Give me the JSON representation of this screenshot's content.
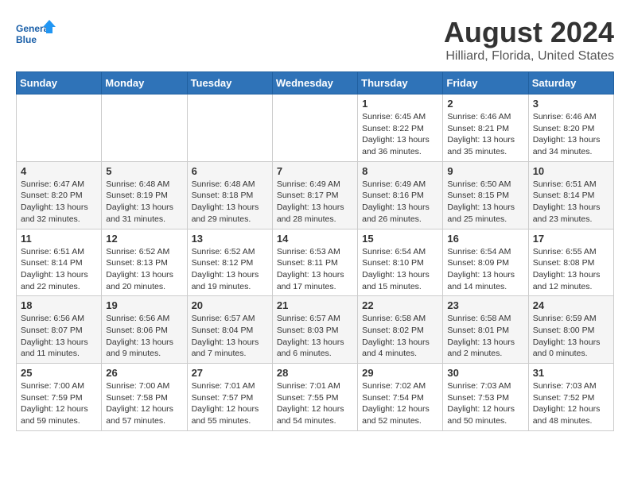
{
  "logo": {
    "name": "General",
    "name2": "Blue"
  },
  "header": {
    "title": "August 2024",
    "subtitle": "Hilliard, Florida, United States"
  },
  "weekdays": [
    "Sunday",
    "Monday",
    "Tuesday",
    "Wednesday",
    "Thursday",
    "Friday",
    "Saturday"
  ],
  "weeks": [
    [
      {
        "day": "",
        "info": ""
      },
      {
        "day": "",
        "info": ""
      },
      {
        "day": "",
        "info": ""
      },
      {
        "day": "",
        "info": ""
      },
      {
        "day": "1",
        "info": "Sunrise: 6:45 AM\nSunset: 8:22 PM\nDaylight: 13 hours\nand 36 minutes."
      },
      {
        "day": "2",
        "info": "Sunrise: 6:46 AM\nSunset: 8:21 PM\nDaylight: 13 hours\nand 35 minutes."
      },
      {
        "day": "3",
        "info": "Sunrise: 6:46 AM\nSunset: 8:20 PM\nDaylight: 13 hours\nand 34 minutes."
      }
    ],
    [
      {
        "day": "4",
        "info": "Sunrise: 6:47 AM\nSunset: 8:20 PM\nDaylight: 13 hours\nand 32 minutes."
      },
      {
        "day": "5",
        "info": "Sunrise: 6:48 AM\nSunset: 8:19 PM\nDaylight: 13 hours\nand 31 minutes."
      },
      {
        "day": "6",
        "info": "Sunrise: 6:48 AM\nSunset: 8:18 PM\nDaylight: 13 hours\nand 29 minutes."
      },
      {
        "day": "7",
        "info": "Sunrise: 6:49 AM\nSunset: 8:17 PM\nDaylight: 13 hours\nand 28 minutes."
      },
      {
        "day": "8",
        "info": "Sunrise: 6:49 AM\nSunset: 8:16 PM\nDaylight: 13 hours\nand 26 minutes."
      },
      {
        "day": "9",
        "info": "Sunrise: 6:50 AM\nSunset: 8:15 PM\nDaylight: 13 hours\nand 25 minutes."
      },
      {
        "day": "10",
        "info": "Sunrise: 6:51 AM\nSunset: 8:14 PM\nDaylight: 13 hours\nand 23 minutes."
      }
    ],
    [
      {
        "day": "11",
        "info": "Sunrise: 6:51 AM\nSunset: 8:14 PM\nDaylight: 13 hours\nand 22 minutes."
      },
      {
        "day": "12",
        "info": "Sunrise: 6:52 AM\nSunset: 8:13 PM\nDaylight: 13 hours\nand 20 minutes."
      },
      {
        "day": "13",
        "info": "Sunrise: 6:52 AM\nSunset: 8:12 PM\nDaylight: 13 hours\nand 19 minutes."
      },
      {
        "day": "14",
        "info": "Sunrise: 6:53 AM\nSunset: 8:11 PM\nDaylight: 13 hours\nand 17 minutes."
      },
      {
        "day": "15",
        "info": "Sunrise: 6:54 AM\nSunset: 8:10 PM\nDaylight: 13 hours\nand 15 minutes."
      },
      {
        "day": "16",
        "info": "Sunrise: 6:54 AM\nSunset: 8:09 PM\nDaylight: 13 hours\nand 14 minutes."
      },
      {
        "day": "17",
        "info": "Sunrise: 6:55 AM\nSunset: 8:08 PM\nDaylight: 13 hours\nand 12 minutes."
      }
    ],
    [
      {
        "day": "18",
        "info": "Sunrise: 6:56 AM\nSunset: 8:07 PM\nDaylight: 13 hours\nand 11 minutes."
      },
      {
        "day": "19",
        "info": "Sunrise: 6:56 AM\nSunset: 8:06 PM\nDaylight: 13 hours\nand 9 minutes."
      },
      {
        "day": "20",
        "info": "Sunrise: 6:57 AM\nSunset: 8:04 PM\nDaylight: 13 hours\nand 7 minutes."
      },
      {
        "day": "21",
        "info": "Sunrise: 6:57 AM\nSunset: 8:03 PM\nDaylight: 13 hours\nand 6 minutes."
      },
      {
        "day": "22",
        "info": "Sunrise: 6:58 AM\nSunset: 8:02 PM\nDaylight: 13 hours\nand 4 minutes."
      },
      {
        "day": "23",
        "info": "Sunrise: 6:58 AM\nSunset: 8:01 PM\nDaylight: 13 hours\nand 2 minutes."
      },
      {
        "day": "24",
        "info": "Sunrise: 6:59 AM\nSunset: 8:00 PM\nDaylight: 13 hours\nand 0 minutes."
      }
    ],
    [
      {
        "day": "25",
        "info": "Sunrise: 7:00 AM\nSunset: 7:59 PM\nDaylight: 12 hours\nand 59 minutes."
      },
      {
        "day": "26",
        "info": "Sunrise: 7:00 AM\nSunset: 7:58 PM\nDaylight: 12 hours\nand 57 minutes."
      },
      {
        "day": "27",
        "info": "Sunrise: 7:01 AM\nSunset: 7:57 PM\nDaylight: 12 hours\nand 55 minutes."
      },
      {
        "day": "28",
        "info": "Sunrise: 7:01 AM\nSunset: 7:55 PM\nDaylight: 12 hours\nand 54 minutes."
      },
      {
        "day": "29",
        "info": "Sunrise: 7:02 AM\nSunset: 7:54 PM\nDaylight: 12 hours\nand 52 minutes."
      },
      {
        "day": "30",
        "info": "Sunrise: 7:03 AM\nSunset: 7:53 PM\nDaylight: 12 hours\nand 50 minutes."
      },
      {
        "day": "31",
        "info": "Sunrise: 7:03 AM\nSunset: 7:52 PM\nDaylight: 12 hours\nand 48 minutes."
      }
    ]
  ]
}
